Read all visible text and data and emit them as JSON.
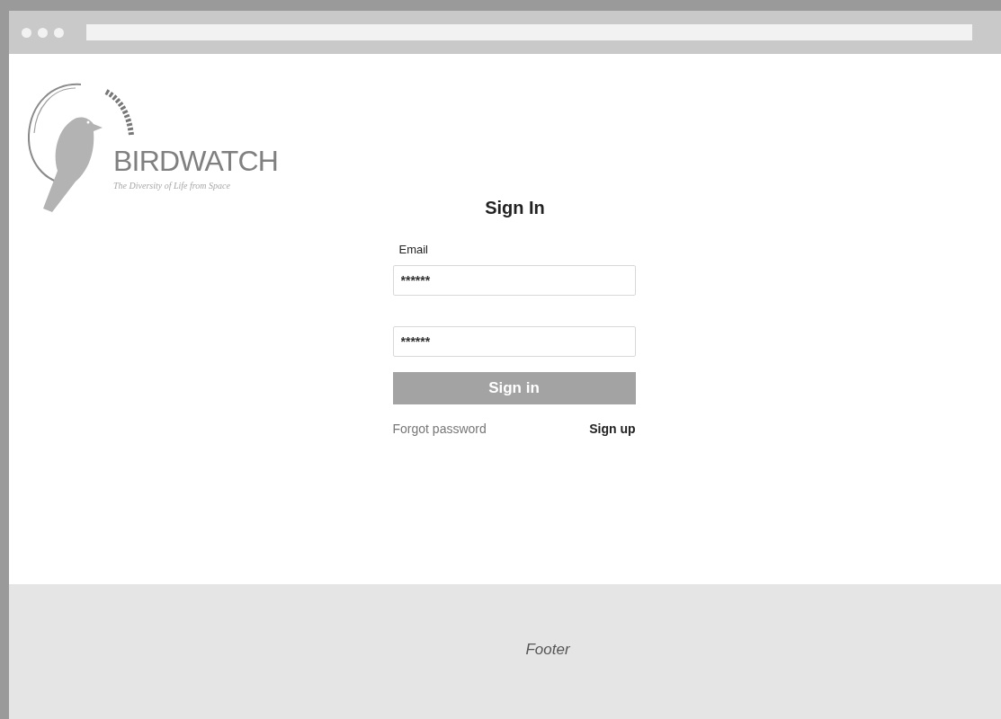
{
  "logo": {
    "name": "BIRDWATCH",
    "tagline": "The Diversity of Life from Space"
  },
  "form": {
    "title": "Sign In",
    "email_label": "Email",
    "fields": [
      {
        "value": "******"
      },
      {
        "value": "******"
      }
    ],
    "submit": {
      "label": "Sign in",
      "disabled": true
    },
    "links": [
      {
        "label": "Forgot password",
        "kind": "muted"
      },
      {
        "label": "Sign up",
        "kind": "strong"
      }
    ]
  },
  "footer": {
    "text": "Footer"
  }
}
